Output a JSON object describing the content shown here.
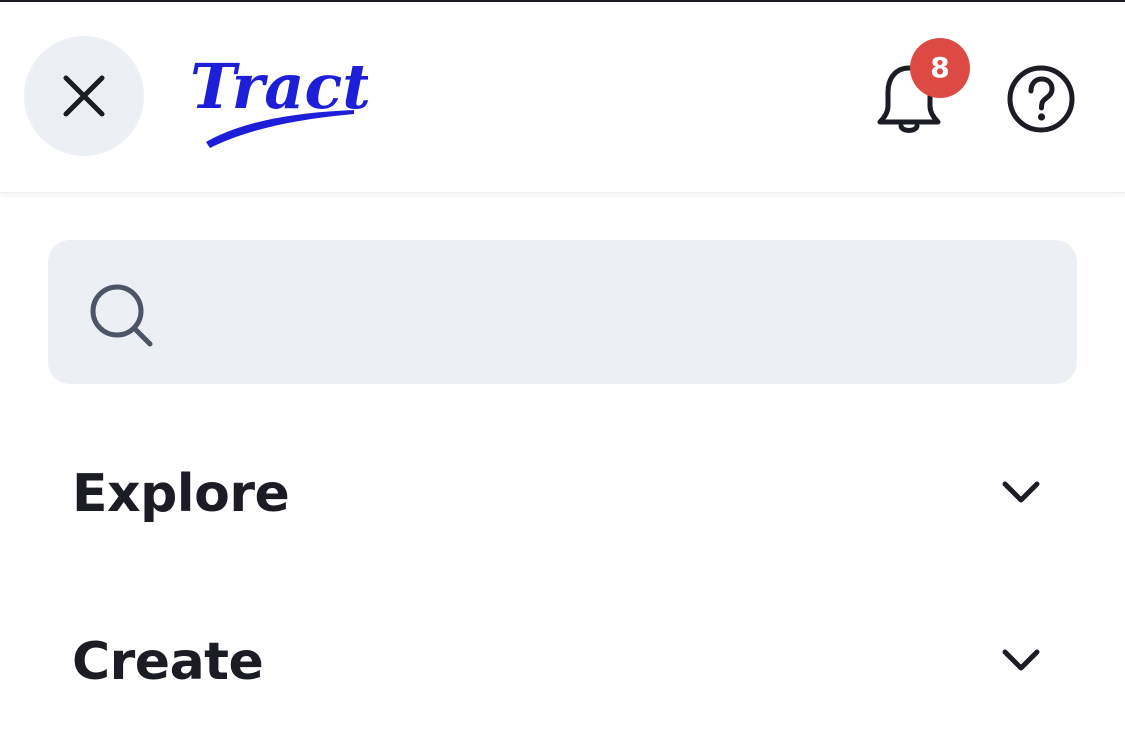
{
  "header": {
    "logo_text": "Tract",
    "notification_count": "8",
    "close_icon": "close-icon",
    "bell_icon": "bell-icon",
    "help_icon": "help-circle-icon",
    "colors": {
      "brand": "#1d1ed8",
      "badge": "#dc4a43",
      "button_bg": "#eceff4"
    }
  },
  "search": {
    "icon": "search-icon",
    "value": "",
    "placeholder": ""
  },
  "nav": {
    "items": [
      {
        "label": "Explore",
        "icon": "chevron-down-icon"
      },
      {
        "label": "Create",
        "icon": "chevron-down-icon"
      }
    ]
  }
}
